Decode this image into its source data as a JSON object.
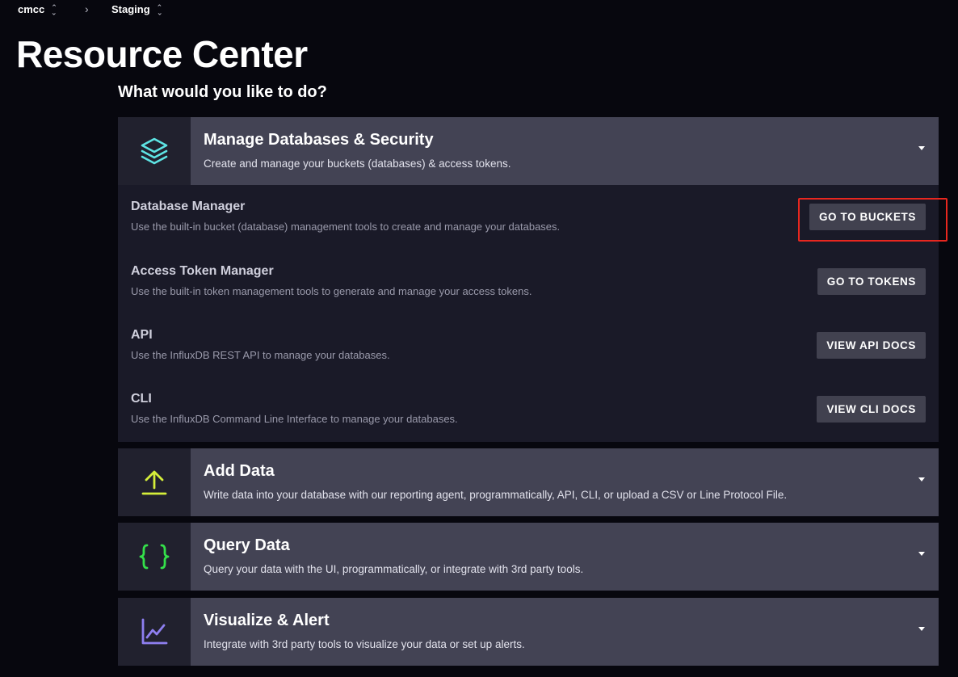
{
  "breadcrumb": {
    "org": "cmcc",
    "separator": "›",
    "bucket": "Staging"
  },
  "page_title": "Resource Center",
  "question": "What would you like to do?",
  "sections": [
    {
      "title": "Manage Databases & Security",
      "description": "Create and manage your buckets (databases) & access tokens.",
      "icon": "layers-icon",
      "icon_color": "#5ee4e4",
      "expanded": true,
      "items": [
        {
          "title": "Database Manager",
          "description": "Use the built-in bucket (database) management tools to create and manage your databases.",
          "button": "GO TO BUCKETS"
        },
        {
          "title": "Access Token Manager",
          "description": "Use the built-in token management tools to generate and manage your access tokens.",
          "button": "GO TO TOKENS"
        },
        {
          "title": "API",
          "description": "Use the InfluxDB REST API to manage your databases.",
          "button": "VIEW API DOCS"
        },
        {
          "title": "CLI",
          "description": "Use the InfluxDB Command Line Interface to manage your databases.",
          "button": "VIEW CLI DOCS"
        }
      ]
    },
    {
      "title": "Add Data",
      "description": "Write data into your database with our reporting agent, programmatically, API, CLI, or upload a CSV or Line Protocol File.",
      "icon": "upload-icon",
      "icon_color": "#d5ee3a",
      "expanded": false
    },
    {
      "title": "Query Data",
      "description": "Query your data with the UI, programmatically, or integrate with 3rd party tools.",
      "icon": "braces-icon",
      "icon_color": "#34e04a",
      "expanded": false
    },
    {
      "title": "Visualize & Alert",
      "description": "Integrate with 3rd party tools to visualize your data or set up alerts.",
      "icon": "line-chart-icon",
      "icon_color": "#8e7ff0",
      "expanded": false
    }
  ],
  "highlight_color": "#e8271f"
}
